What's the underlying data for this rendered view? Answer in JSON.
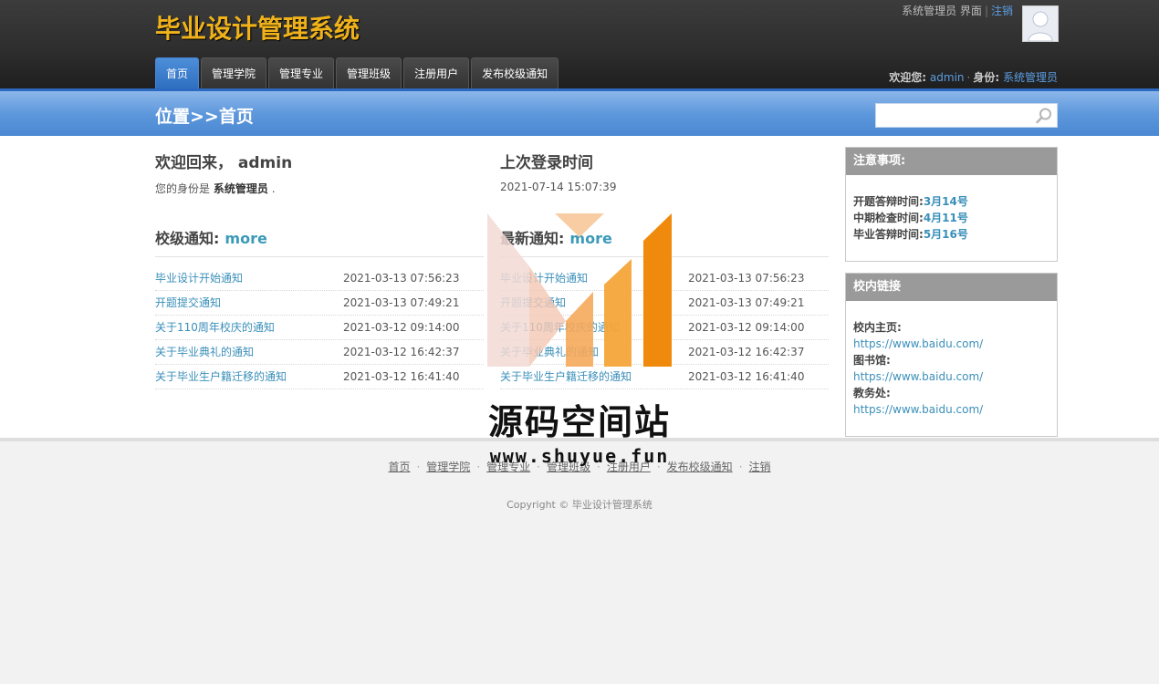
{
  "app": {
    "title": "毕业设计管理系统"
  },
  "top": {
    "role_interface": "系统管理员 界面",
    "logout": "注销"
  },
  "nav": {
    "items": [
      {
        "label": "首页",
        "active": true
      },
      {
        "label": "管理学院"
      },
      {
        "label": "管理专业"
      },
      {
        "label": "管理班级"
      },
      {
        "label": "注册用户"
      },
      {
        "label": "发布校级通知"
      }
    ]
  },
  "welcome_bar": {
    "welcome_label": "欢迎您:",
    "username": "admin",
    "role_label": "身份:",
    "role": "系统管理员"
  },
  "location": {
    "title": "位置>>首页"
  },
  "search": {
    "placeholder": "",
    "value": ""
  },
  "main": {
    "welcome_title": "欢迎回来， admin",
    "identity_prefix": "您的身份是",
    "identity_role": "系统管理员",
    "identity_suffix": ".",
    "last_login_title": "上次登录时间",
    "last_login_time": "2021-07-14 15:07:39",
    "school_notice_title": "校级通知:",
    "latest_notice_title": "最新通知:",
    "more": "more",
    "school_notices": [
      {
        "title": "毕业设计开始通知",
        "date": "2021-03-13 07:56:23"
      },
      {
        "title": "开题提交通知",
        "date": "2021-03-13 07:49:21"
      },
      {
        "title": "关于110周年校庆的通知",
        "date": "2021-03-12 09:14:00"
      },
      {
        "title": "关于毕业典礼的通知",
        "date": "2021-03-12 16:42:37"
      },
      {
        "title": "关于毕业生户籍迁移的通知",
        "date": "2021-03-12 16:41:40"
      }
    ],
    "latest_notices": [
      {
        "title": "毕业设计开始通知",
        "date": "2021-03-13 07:56:23"
      },
      {
        "title": "开题提交通知",
        "date": "2021-03-13 07:49:21"
      },
      {
        "title": "关于110周年校庆的通知",
        "date": "2021-03-12 09:14:00"
      },
      {
        "title": "关于毕业典礼的通知",
        "date": "2021-03-12 16:42:37"
      },
      {
        "title": "关于毕业生户籍迁移的通知",
        "date": "2021-03-12 16:41:40"
      }
    ]
  },
  "side": {
    "notes_title": "注意事项:",
    "notes": [
      {
        "label": "开题答辩时间:",
        "value": "3月14号"
      },
      {
        "label": "中期检查时间:",
        "value": "4月11号"
      },
      {
        "label": "毕业答辩时间:",
        "value": "5月16号"
      }
    ],
    "links_title": "校内链接",
    "links": [
      {
        "label": "校内主页:",
        "url": "https://www.baidu.com/"
      },
      {
        "label": "图书馆:",
        "url": "https://www.baidu.com/"
      },
      {
        "label": "教务处:",
        "url": "https://www.baidu.com/"
      }
    ]
  },
  "footer": {
    "links": [
      "首页",
      "管理学院",
      "管理专业",
      "管理班级",
      "注册用户",
      "发布校级通知",
      "注销"
    ],
    "copyright": "Copyright © 毕业设计管理系统"
  },
  "watermark": {
    "text": "源码空间站",
    "url": "www.shuyue.fun"
  },
  "colors": {
    "logo": "#f0b21a",
    "nav_active": "#2f6fc0",
    "link": "#3a8fb9",
    "watermark_orange": "#f6a53a"
  }
}
